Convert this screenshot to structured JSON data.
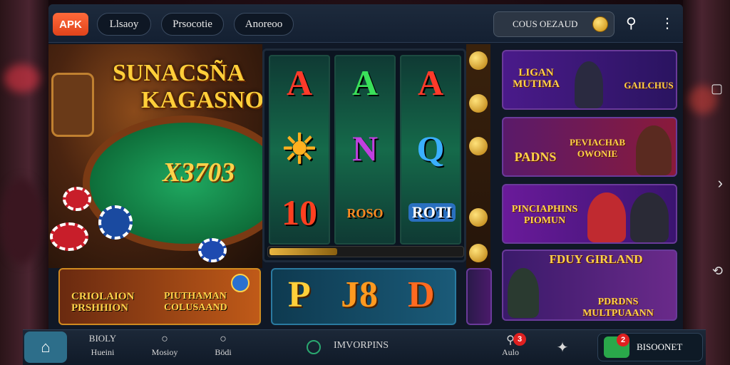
{
  "header": {
    "apk_label": "APK",
    "tabs": [
      {
        "label": "Llsaoy"
      },
      {
        "label": "Prsocotie"
      },
      {
        "label": "Anoreoo"
      }
    ],
    "balance_label": "COUS OEZAUD",
    "search_icon": "search-icon",
    "menu_icon": "more-vert-icon"
  },
  "hero": {
    "title_line1": "SUNACSÑA",
    "title_line2": "KAGASNO",
    "table_number": "X3703"
  },
  "slot": {
    "reels": [
      [
        "A",
        "☀",
        "10"
      ],
      [
        "A",
        "N",
        "ROSO"
      ],
      [
        "A",
        "Q",
        "ROTI"
      ]
    ],
    "progress": 0.35
  },
  "cards": [
    {
      "left": "LIGAN MUTIMA",
      "right": "GAILCHUS"
    },
    {
      "left": "PADNS",
      "right": "PEVIACHAB OWONIE"
    },
    {
      "left": "PINCIAPHINS PIOMUN",
      "right": ""
    },
    {
      "left": "FDUY GIRLAND",
      "right": "PDRDNS MULTPUAANN"
    }
  ],
  "banners": [
    {
      "left": "CRIOLAION PRSHHION",
      "right": "PIUTHAMAN COLUSAAND"
    },
    {
      "symbols": [
        "P",
        "J8",
        "D"
      ]
    }
  ],
  "nav": {
    "items": [
      {
        "label": "Hueini",
        "top": "BIOLY"
      },
      {
        "label": "Mosioy"
      },
      {
        "label": "Bödi"
      },
      {
        "label": "IMVORPINS"
      },
      {
        "label": "Aulo",
        "badge": "3"
      },
      {
        "label": ""
      }
    ],
    "bonus_label": "BISOONET",
    "bonus_badge": "2"
  },
  "colors": {
    "accent": "#ffcf3a",
    "apk": "#e0431b",
    "felt": "#1fa860",
    "badge": "#e02020"
  }
}
